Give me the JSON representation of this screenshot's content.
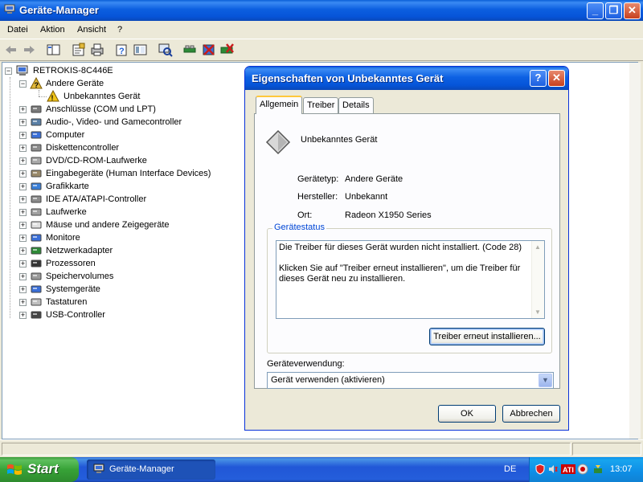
{
  "window": {
    "title": "Geräte-Manager"
  },
  "menu": [
    "Datei",
    "Aktion",
    "Ansicht",
    "?"
  ],
  "tree": {
    "root": "RETROKIS-8C446E",
    "items": [
      {
        "label": "Andere Geräte",
        "expanded": true,
        "icon": "question-device-icon"
      },
      {
        "label": "Unbekanntes Gerät",
        "child": true,
        "icon": "unknown-device-warning-icon"
      },
      {
        "label": "Anschlüsse (COM und LPT)",
        "icon": "port-icon"
      },
      {
        "label": "Audio-, Video- und Gamecontroller",
        "icon": "speaker-icon"
      },
      {
        "label": "Computer",
        "icon": "computer-icon"
      },
      {
        "label": "Diskettencontroller",
        "icon": "floppy-controller-icon"
      },
      {
        "label": "DVD/CD-ROM-Laufwerke",
        "icon": "cd-drive-icon"
      },
      {
        "label": "Eingabegeräte (Human Interface Devices)",
        "icon": "hid-icon"
      },
      {
        "label": "Grafikkarte",
        "icon": "display-adapter-icon"
      },
      {
        "label": "IDE ATA/ATAPI-Controller",
        "icon": "ide-controller-icon"
      },
      {
        "label": "Laufwerke",
        "icon": "disk-drive-icon"
      },
      {
        "label": "Mäuse und andere Zeigegeräte",
        "icon": "mouse-icon"
      },
      {
        "label": "Monitore",
        "icon": "monitor-icon"
      },
      {
        "label": "Netzwerkadapter",
        "icon": "network-adapter-icon"
      },
      {
        "label": "Prozessoren",
        "icon": "processor-icon"
      },
      {
        "label": "Speichervolumes",
        "icon": "storage-volume-icon"
      },
      {
        "label": "Systemgeräte",
        "icon": "system-device-icon"
      },
      {
        "label": "Tastaturen",
        "icon": "keyboard-icon"
      },
      {
        "label": "USB-Controller",
        "icon": "usb-icon"
      }
    ]
  },
  "dialog": {
    "title": "Eigenschaften von Unbekanntes Gerät",
    "tabs": [
      "Allgemein",
      "Treiber",
      "Details"
    ],
    "device_name": "Unbekanntes Gerät",
    "props": {
      "type_label": "Gerätetyp:",
      "type_value": "Andere Geräte",
      "maker_label": "Hersteller:",
      "maker_value": "Unbekannt",
      "location_label": "Ort:",
      "location_value": "Radeon X1950 Series"
    },
    "status_group": "Gerätestatus",
    "status_line1": "Die Treiber für dieses Gerät wurden nicht installiert. (Code 28)",
    "status_line2": "Klicken Sie auf \"Treiber erneut installieren\", um die Treiber für dieses Gerät neu zu installieren.",
    "reinstall_button": "Treiber erneut installieren...",
    "usage_label": "Geräteverwendung:",
    "usage_value": "Gerät verwenden (aktivieren)",
    "ok": "OK",
    "cancel": "Abbrechen"
  },
  "taskbar": {
    "start": "Start",
    "task": "Geräte-Manager",
    "lang": "DE",
    "clock": "13:07"
  }
}
